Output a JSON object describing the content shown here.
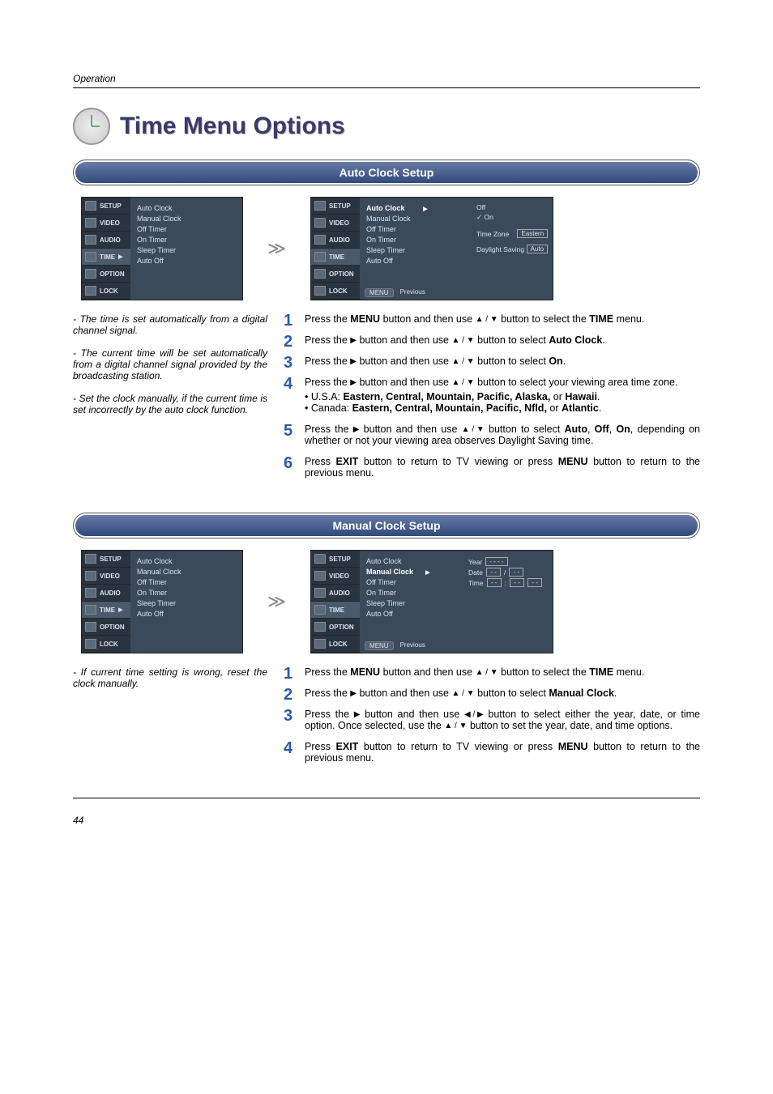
{
  "header": {
    "section": "Operation",
    "page_number": "44"
  },
  "title": "Time Menu Options",
  "arrows": {
    "right": "▶",
    "up": "▲",
    "down": "▼",
    "left": "◀",
    "updown": "▲ / ▼",
    "leftright": "◀ / ▶"
  },
  "menu_nav": [
    "SETUP",
    "VIDEO",
    "AUDIO",
    "TIME",
    "OPTION",
    "LOCK"
  ],
  "time_submenu": [
    "Auto Clock",
    "Manual Clock",
    "Off Timer",
    "On Timer",
    "Sleep Timer",
    "Auto Off"
  ],
  "section1": {
    "heading": "Auto Clock Setup",
    "right_panel": {
      "off": "Off",
      "on": "On",
      "tz_label": "Time Zone",
      "tz_value": "Eastern",
      "ds_label": "Daylight Saving",
      "ds_value": "Auto"
    },
    "footer": {
      "menu": "MENU",
      "prev": "Previous"
    },
    "notes": [
      "The time is set automatically from a digital channel signal.",
      "The current time will be set automatically from a digital channel signal provided by the broadcasting station.",
      "Set the clock manually, if the current time is set incorrectly by the auto clock function."
    ],
    "steps": {
      "s1a": "Press the ",
      "s1b": "MENU",
      "s1c": " button and then use ",
      "s1d": " button to select the ",
      "s1e": "TIME",
      "s1f": " menu.",
      "s2a": "Press the ",
      "s2b": " button and then use ",
      "s2c": " button to select ",
      "s2d": "Auto Clock",
      "s2e": ".",
      "s3a": "Press the ",
      "s3b": " button and then use ",
      "s3c": " button to select ",
      "s3d": "On",
      "s3e": ".",
      "s4a": "Press the ",
      "s4b": " button and then use ",
      "s4c": " button to select your viewing area time zone.",
      "s4usa_label": "U.S.A: ",
      "s4usa": "Eastern, Central, Mountain, Pacific, Alaska, ",
      "s4usa_or": "or ",
      "s4usa_last": "Hawaii",
      "s4can_label": "Canada: ",
      "s4can": "Eastern, Central, Mountain, Pacific, Nfld, ",
      "s4can_or": "or ",
      "s4can_last": "Atlantic",
      "s5a": "Press the ",
      "s5b": " button and then use ",
      "s5c": " button to select ",
      "s5d": "Auto",
      "s5e": ", ",
      "s5f": "Off",
      "s5g": ", ",
      "s5h": "On",
      "s5i": ", depending on whether or not your viewing area observes Daylight Saving time.",
      "s6a": "Press ",
      "s6b": "EXIT",
      "s6c": " button to return to TV viewing or press ",
      "s6d": "MENU",
      "s6e": " button to return to the previous menu."
    }
  },
  "section2": {
    "heading": "Manual Clock Setup",
    "manual_panel": {
      "year_label": "Year",
      "year_value": "- - - -",
      "date_label": "Date",
      "date_v1": "- -",
      "date_sep": "/",
      "date_v2": "- -",
      "time_label": "Time",
      "time_v1": "- -",
      "time_sep": ":",
      "time_v2": "- -",
      "time_v3": "- -"
    },
    "footer": {
      "menu": "MENU",
      "prev": "Previous"
    },
    "notes": [
      "If current time setting is wrong, reset the clock manually."
    ],
    "steps": {
      "s1a": "Press the ",
      "s1b": "MENU",
      "s1c": " button and then use ",
      "s1d": " button to select the ",
      "s1e": "TIME",
      "s1f": " menu.",
      "s2a": "Press the ",
      "s2b": " button and then use ",
      "s2c": " button to select ",
      "s2d": "Manual Clock",
      "s2e": ".",
      "s3a": "Press the ",
      "s3b": " button and then use ",
      "s3c": " button to select either the year, date, or time option. Once selected, use the ",
      "s3d": " button to set the year, date, and time options.",
      "s4a": "Press ",
      "s4b": "EXIT",
      "s4c": " button to return to TV viewing or press ",
      "s4d": "MENU",
      "s4e": " button to return to the previous menu."
    }
  }
}
